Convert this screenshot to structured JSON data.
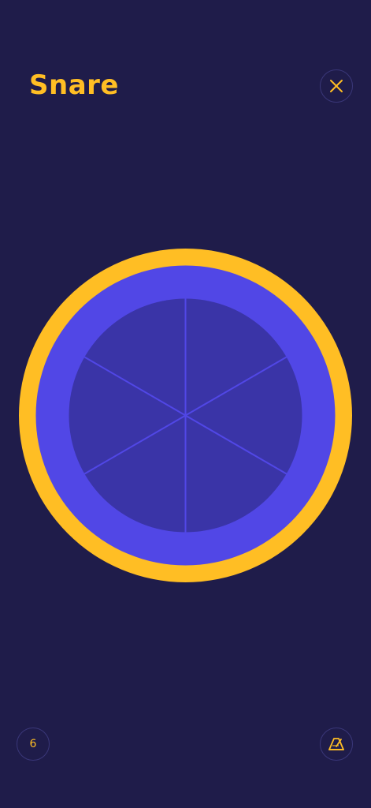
{
  "header": {
    "title": "Snare"
  },
  "footer": {
    "count_label": "6"
  },
  "drum": {
    "segments": 6
  },
  "colors": {
    "background": "#1F1C4A",
    "accent": "#FFBE24",
    "rim": "#5147E6",
    "pad": "#3A34A7"
  },
  "icons": {
    "close": "close-icon",
    "metronome": "metronome-icon"
  }
}
